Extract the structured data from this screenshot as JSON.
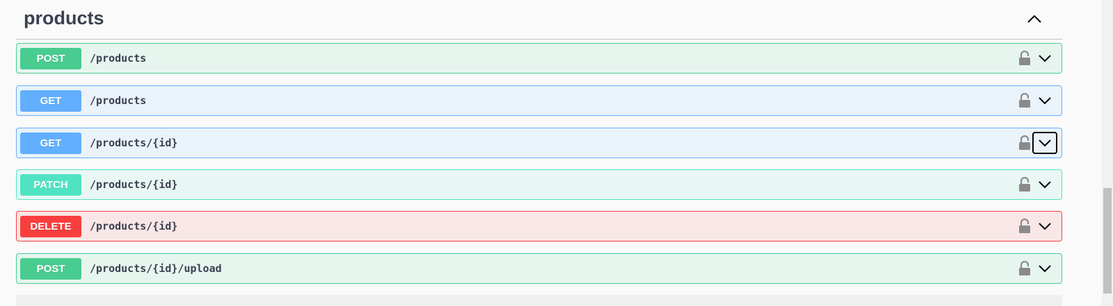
{
  "section": {
    "title": "products",
    "collapse_icon": "chevron-up-icon"
  },
  "operations": [
    {
      "method": "POST",
      "path": "/products",
      "color": "#49cc90",
      "lock_icon": "lock-icon",
      "expand_icon": "chevron-down-icon"
    },
    {
      "method": "GET",
      "path": "/products",
      "color": "#61affe",
      "lock_icon": "lock-icon",
      "expand_icon": "chevron-down-icon"
    },
    {
      "method": "GET",
      "path": "/products/{id}",
      "color": "#61affe",
      "lock_icon": "lock-icon",
      "expand_icon": "chevron-down-icon",
      "focused": true
    },
    {
      "method": "PATCH",
      "path": "/products/{id}",
      "color": "#50e3c2",
      "lock_icon": "lock-icon",
      "expand_icon": "chevron-down-icon"
    },
    {
      "method": "DELETE",
      "path": "/products/{id}",
      "color": "#f93e3e",
      "lock_icon": "lock-icon",
      "expand_icon": "chevron-down-icon"
    },
    {
      "method": "POST",
      "path": "/products/{id}/upload",
      "color": "#49cc90",
      "lock_icon": "lock-icon",
      "expand_icon": "chevron-down-icon"
    }
  ]
}
